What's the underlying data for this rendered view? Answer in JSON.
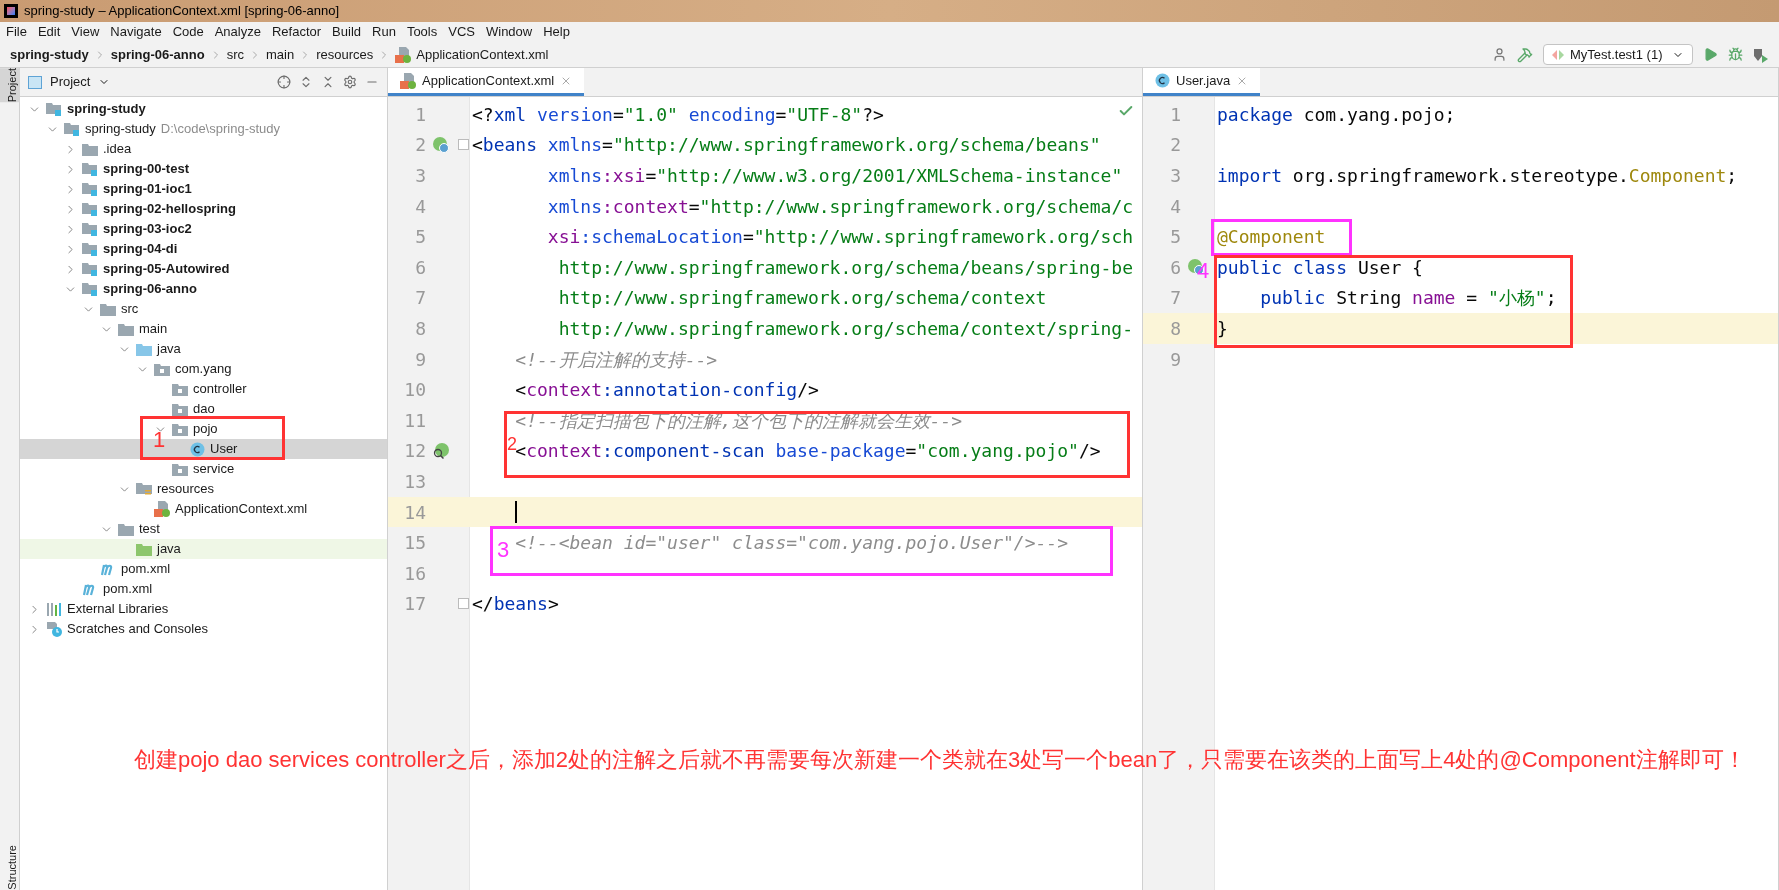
{
  "window": {
    "title": "spring-study – ApplicationContext.xml [spring-06-anno]"
  },
  "menu": [
    "File",
    "Edit",
    "View",
    "Navigate",
    "Code",
    "Analyze",
    "Refactor",
    "Build",
    "Run",
    "Tools",
    "VCS",
    "Window",
    "Help"
  ],
  "breadcrumb": [
    {
      "label": "spring-study",
      "bold": true
    },
    {
      "label": "spring-06-anno",
      "bold": true
    },
    {
      "label": "src",
      "bold": false
    },
    {
      "label": "main",
      "bold": false
    },
    {
      "label": "resources",
      "bold": false
    },
    {
      "label": "ApplicationContext.xml",
      "bold": false
    }
  ],
  "toolbar": {
    "run_config": "MyTest.test1 (1)"
  },
  "side_tabs": [
    {
      "label": "Project",
      "selected": true
    },
    {
      "label": "Structure",
      "selected": false
    }
  ],
  "project": {
    "title": "Project",
    "tree": [
      {
        "label": "spring-study",
        "kind": "module",
        "bold": true,
        "expanded": true,
        "selected": false,
        "children": [
          {
            "label": "spring-study",
            "hint": "D:\\code\\spring-study",
            "kind": "module",
            "bold": false,
            "expanded": true,
            "selected": false,
            "children": [
              {
                "label": ".idea",
                "kind": "folder",
                "bold": false,
                "expanded": false,
                "selected": false
              },
              {
                "label": "spring-00-test",
                "kind": "module",
                "bold": true,
                "expanded": false,
                "selected": false
              },
              {
                "label": "spring-01-ioc1",
                "kind": "module",
                "bold": true,
                "expanded": false,
                "selected": false
              },
              {
                "label": "spring-02-hellospring",
                "kind": "module",
                "bold": true,
                "expanded": false,
                "selected": false
              },
              {
                "label": "spring-03-ioc2",
                "kind": "module",
                "bold": true,
                "expanded": false,
                "selected": false
              },
              {
                "label": "spring-04-di",
                "kind": "module",
                "bold": true,
                "expanded": false,
                "selected": false
              },
              {
                "label": "spring-05-Autowired",
                "kind": "module",
                "bold": true,
                "expanded": false,
                "selected": false
              },
              {
                "label": "spring-06-anno",
                "kind": "module",
                "bold": true,
                "expanded": true,
                "selected": false,
                "children": [
                  {
                    "label": "src",
                    "kind": "folder",
                    "bold": false,
                    "expanded": true,
                    "selected": false,
                    "children": [
                      {
                        "label": "main",
                        "kind": "folder",
                        "bold": false,
                        "expanded": true,
                        "selected": false,
                        "children": [
                          {
                            "label": "java",
                            "kind": "source",
                            "bold": false,
                            "expanded": true,
                            "selected": false,
                            "children": [
                              {
                                "label": "com.yang",
                                "kind": "package",
                                "bold": false,
                                "expanded": true,
                                "selected": false,
                                "children": [
                                  {
                                    "label": "controller",
                                    "kind": "package",
                                    "bold": false,
                                    "selected": false
                                  },
                                  {
                                    "label": "dao",
                                    "kind": "package",
                                    "bold": false,
                                    "selected": false
                                  },
                                  {
                                    "label": "pojo",
                                    "kind": "package",
                                    "bold": false,
                                    "expanded": true,
                                    "selected": false,
                                    "children": [
                                      {
                                        "label": "User",
                                        "kind": "class",
                                        "bold": false,
                                        "selected": true
                                      }
                                    ]
                                  },
                                  {
                                    "label": "service",
                                    "kind": "package",
                                    "bold": false,
                                    "selected": false
                                  }
                                ]
                              }
                            ]
                          },
                          {
                            "label": "resources",
                            "kind": "resources",
                            "bold": false,
                            "expanded": true,
                            "selected": false,
                            "children": [
                              {
                                "label": "ApplicationContext.xml",
                                "kind": "xml",
                                "bold": false,
                                "selected": false
                              }
                            ]
                          }
                        ]
                      },
                      {
                        "label": "test",
                        "kind": "folder",
                        "bold": false,
                        "expanded": true,
                        "selected": false,
                        "children": [
                          {
                            "label": "java",
                            "kind": "test-source",
                            "bold": false,
                            "selected": false
                          }
                        ]
                      }
                    ]
                  },
                  {
                    "label": "pom.xml",
                    "kind": "maven",
                    "bold": false,
                    "selected": false
                  }
                ]
              },
              {
                "label": "pom.xml",
                "kind": "maven",
                "bold": false,
                "selected": false
              }
            ]
          }
        ]
      },
      {
        "label": "External Libraries",
        "kind": "libraries",
        "bold": false,
        "expanded": false,
        "selected": false
      },
      {
        "label": "Scratches and Consoles",
        "kind": "scratches",
        "bold": false,
        "expanded": false,
        "selected": false
      }
    ]
  },
  "editors": [
    {
      "tab": {
        "label": "ApplicationContext.xml",
        "kind": "xml",
        "selected": true
      },
      "lines": [
        {
          "number": "1",
          "kind": "top",
          "current": false,
          "tokens": [
            {
              "t": "<?",
              "kind": "plain"
            },
            {
              "t": "xml",
              "kind": "tag"
            },
            {
              "t": " version",
              "kind": "attr"
            },
            {
              "t": "=",
              "kind": "plain"
            },
            {
              "t": "\"1.0\"",
              "kind": "value"
            },
            {
              "t": " encoding",
              "kind": "attr"
            },
            {
              "t": "=",
              "kind": "plain"
            },
            {
              "t": "\"UTF-8\"",
              "kind": "value"
            },
            {
              "t": "?>",
              "kind": "plain"
            }
          ]
        },
        {
          "number": "2",
          "kind": "top",
          "current": false,
          "gutter": {
            "kind": "bean"
          },
          "fold": true,
          "tokens": [
            {
              "t": "<",
              "kind": "plain"
            },
            {
              "t": "beans",
              "kind": "tag"
            },
            {
              "t": " xmlns",
              "kind": "attr"
            },
            {
              "t": "=",
              "kind": "plain"
            },
            {
              "t": "\"http://www.springframework.org/schema/beans\"",
              "kind": "value"
            }
          ]
        },
        {
          "number": "3",
          "kind": "attribute",
          "current": false,
          "tokens": [
            {
              "t": "xmlns",
              "kind": "attr"
            },
            {
              "t": ":xsi",
              "kind": "ns"
            },
            {
              "t": "=",
              "kind": "plain"
            },
            {
              "t": "\"http://www.w3.org/2001/XMLSchema-instance\"",
              "kind": "value"
            }
          ]
        },
        {
          "number": "4",
          "kind": "attribute",
          "current": false,
          "tokens": [
            {
              "t": "xmlns",
              "kind": "attr"
            },
            {
              "t": ":context",
              "kind": "ns"
            },
            {
              "t": "=",
              "kind": "plain"
            },
            {
              "t": "\"http://www.springframework.org/schema/c",
              "kind": "value"
            }
          ]
        },
        {
          "number": "5",
          "kind": "attribute",
          "current": false,
          "tokens": [
            {
              "t": "xsi",
              "kind": "ns"
            },
            {
              "t": ":schemaLocation",
              "kind": "attr"
            },
            {
              "t": "=",
              "kind": "plain"
            },
            {
              "t": "\"http://www.springframework.org/sch",
              "kind": "value"
            }
          ]
        },
        {
          "number": "6",
          "kind": "continuation",
          "current": false,
          "tokens": [
            {
              "t": "http://www.springframework.org/schema/beans/spring-be",
              "kind": "value"
            }
          ]
        },
        {
          "number": "7",
          "kind": "continuation",
          "current": false,
          "tokens": [
            {
              "t": "http://www.springframework.org/schema/context",
              "kind": "value"
            }
          ]
        },
        {
          "number": "8",
          "kind": "continuation",
          "current": false,
          "tokens": [
            {
              "t": "http://www.springframework.org/schema/context/spring-",
              "kind": "value"
            }
          ]
        },
        {
          "number": "9",
          "kind": "child",
          "current": false,
          "tokens": [
            {
              "t": "<!--开启注解的支持-->",
              "kind": "comment"
            }
          ]
        },
        {
          "number": "10",
          "kind": "child",
          "current": false,
          "tokens": [
            {
              "t": "<",
              "kind": "plain"
            },
            {
              "t": "context",
              "kind": "ns"
            },
            {
              "t": ":annotation-config",
              "kind": "tag"
            },
            {
              "t": "/>",
              "kind": "plain"
            }
          ]
        },
        {
          "number": "11",
          "kind": "child",
          "current": false,
          "tokens": [
            {
              "t": "<!--指定扫描包下的注解,这个包下的注解就会生效-->",
              "kind": "comment"
            }
          ]
        },
        {
          "number": "12",
          "kind": "child",
          "current": false,
          "gutter": {
            "kind": "scan"
          },
          "tokens": [
            {
              "t": "<",
              "kind": "plain"
            },
            {
              "t": "context",
              "kind": "ns"
            },
            {
              "t": ":component-scan",
              "kind": "tag"
            },
            {
              "t": " base-package",
              "kind": "attr"
            },
            {
              "t": "=",
              "kind": "plain"
            },
            {
              "t": "\"com.yang.pojo\"",
              "kind": "value"
            },
            {
              "t": "/>",
              "kind": "plain"
            }
          ]
        },
        {
          "number": "13",
          "kind": "top",
          "current": false
        },
        {
          "number": "14",
          "kind": "child",
          "current": true,
          "caret": true
        },
        {
          "number": "15",
          "kind": "child",
          "current": false,
          "tokens": [
            {
              "t": "<!--<bean id=\"user\" class=\"com.yang.pojo.User\"/>-->",
              "kind": "comment"
            }
          ]
        },
        {
          "number": "16",
          "kind": "top",
          "current": false
        },
        {
          "number": "17",
          "kind": "top",
          "current": false,
          "fold": true,
          "tokens": [
            {
              "t": "</",
              "kind": "plain"
            },
            {
              "t": "beans",
              "kind": "tag"
            },
            {
              "t": ">",
              "kind": "plain"
            }
          ]
        }
      ]
    },
    {
      "tab": {
        "label": "User.java",
        "kind": "class",
        "selected": true
      },
      "lines": [
        {
          "number": "1",
          "kind": "top",
          "current": false,
          "tokens": [
            {
              "t": "package",
              "kind": "keyword"
            },
            {
              "t": " com.yang.pojo;",
              "kind": "plain"
            }
          ]
        },
        {
          "number": "2",
          "kind": "top",
          "current": false
        },
        {
          "number": "3",
          "kind": "top",
          "current": false,
          "tokens": [
            {
              "t": "import",
              "kind": "keyword"
            },
            {
              "t": " org.springframework.stereotype.",
              "kind": "plain"
            },
            {
              "t": "Component",
              "kind": "annotation"
            },
            {
              "t": ";",
              "kind": "plain"
            }
          ]
        },
        {
          "number": "4",
          "kind": "top",
          "current": false
        },
        {
          "number": "5",
          "kind": "top",
          "current": false,
          "tokens": [
            {
              "t": "@Component",
              "kind": "annotation"
            }
          ]
        },
        {
          "number": "6",
          "kind": "top",
          "current": false,
          "gutter": {
            "kind": "bean"
          },
          "tokens": [
            {
              "t": "public class",
              "kind": "keyword"
            },
            {
              "t": " User {",
              "kind": "plain"
            }
          ]
        },
        {
          "number": "7",
          "kind": "child",
          "current": false,
          "tokens": [
            {
              "t": "public",
              "kind": "keyword"
            },
            {
              "t": " String ",
              "kind": "plain"
            },
            {
              "t": "name",
              "kind": "field"
            },
            {
              "t": " = ",
              "kind": "plain"
            },
            {
              "t": "\"小杨\"",
              "kind": "string"
            },
            {
              "t": ";",
              "kind": "plain"
            }
          ]
        },
        {
          "number": "8",
          "kind": "top",
          "current": true,
          "tokens": [
            {
              "t": "}",
              "kind": "plain"
            }
          ]
        },
        {
          "number": "9",
          "kind": "top",
          "current": false
        }
      ]
    }
  ],
  "annotations": [
    {
      "label": "1",
      "color": "#ff3333"
    },
    {
      "label": "2",
      "color": "#ff3333"
    },
    {
      "label": "3",
      "color": "#ff33ff"
    },
    {
      "label": "4",
      "color": "#ff33ff"
    },
    {
      "color": "#ff3333"
    }
  ],
  "note": "创建pojo  dao  services  controller之后，添加2处的注解之后就不再需要每次新建一个类就在3处写一个bean了，只需要在该类的上面写上4处的@Component注解即可！"
}
